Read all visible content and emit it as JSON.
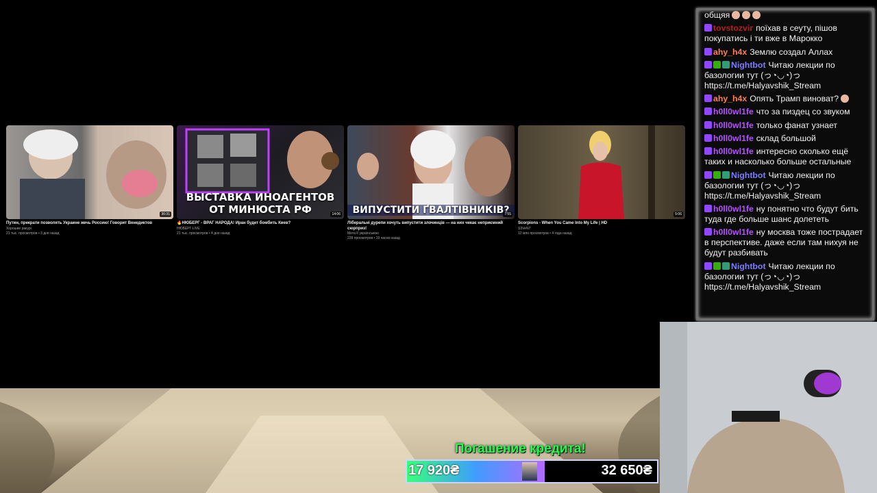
{
  "videos": [
    {
      "title": "Путин, прекрати позволять Украине жечь Россию! Говорит Венедиктов",
      "channel": "Хорошие ракурі",
      "meta": "21 тыс. просмотров • 3 дня назад",
      "duration": "30:31",
      "thumb_text": ""
    },
    {
      "title": "🔥НЮБЕРГ - ВРАГ НАРОДА! Иран будет бомбить Киев?",
      "channel": "НЮБЕРГ LIVE",
      "meta": "21 тыс. просмотров • 4 дня назад",
      "duration": "14:06",
      "thumb_text": "ВЫСТАВКА ИНОАГЕНТОВ ОТ МИНЮСТА РФ"
    },
    {
      "title": "Ліберальні дурепи хочуть випустити злочинців — на них чекає неприємний сюрприз!",
      "channel": "Мета К українською",
      "meta": "228 просмотров • 19 часов назад",
      "duration": "7:55",
      "thumb_text": "ВИПУСТИТИ ҐВАЛТІВНИКІВ?"
    },
    {
      "title": "Scorpions - When You Came Into My Life | HD",
      "channel": "S3VeN7",
      "meta": "12 млн просмотров • 4 года назад",
      "duration": "5:06",
      "thumb_text": ""
    }
  ],
  "chat": [
    {
      "user": "",
      "text": "общяя",
      "badges": [],
      "color": "#ffffff",
      "emotes": 3
    },
    {
      "user": "tovstozvir",
      "text": "поїхав в сеуту, пішов покупатись і ти вже в Марокко",
      "badges": [
        "twitch"
      ],
      "color": "#b22222",
      "emotes": 0
    },
    {
      "user": "ahy_h4x",
      "text": "Землю создал Аллах",
      "badges": [
        "twitch"
      ],
      "color": "#ff7f50",
      "emotes": 0
    },
    {
      "user": "Nightbot",
      "text": "Читаю лекции по базологии тут (っ◔◡◔)っ https://t.me/Halyavshik_Stream",
      "badges": [
        "twitch",
        "mod",
        "bot"
      ],
      "color": "#7c7cff",
      "emotes": 0
    },
    {
      "user": "ahy_h4x",
      "text": "Опять Трамп виноват?",
      "badges": [
        "twitch"
      ],
      "color": "#ff7f50",
      "emotes": 1
    },
    {
      "user": "h0ll0wl1fe",
      "text": "что за пиздец со звуком",
      "badges": [
        "twitch"
      ],
      "color": "#b452ff",
      "emotes": 0
    },
    {
      "user": "h0ll0wl1fe",
      "text": "только фанат узнает",
      "badges": [
        "twitch"
      ],
      "color": "#b452ff",
      "emotes": 0
    },
    {
      "user": "h0ll0wl1fe",
      "text": "склад большой",
      "badges": [
        "twitch"
      ],
      "color": "#b452ff",
      "emotes": 0
    },
    {
      "user": "h0ll0wl1fe",
      "text": "интересно сколько ещё таких и насколько больше остальные",
      "badges": [
        "twitch"
      ],
      "color": "#b452ff",
      "emotes": 0
    },
    {
      "user": "Nightbot",
      "text": "Читаю лекции по базологии тут (っ◔◡◔)っ https://t.me/Halyavshik_Stream",
      "badges": [
        "twitch",
        "mod",
        "bot"
      ],
      "color": "#7c7cff",
      "emotes": 0
    },
    {
      "user": "h0ll0wl1fe",
      "text": "ну понятно что будут бить туда где больше шанс долететь",
      "badges": [
        "twitch"
      ],
      "color": "#b452ff",
      "emotes": 0
    },
    {
      "user": "h0ll0wl1fe",
      "text": "ну москва тоже пострадает в перспективе. даже если там нихуя не будут разбивать",
      "badges": [
        "twitch"
      ],
      "color": "#b452ff",
      "emotes": 0
    },
    {
      "user": "Nightbot",
      "text": "Читаю лекции по базологии тут (っ◔◡◔)っ https://t.me/Halyavshik_Stream",
      "badges": [
        "twitch",
        "mod",
        "bot"
      ],
      "color": "#7c7cff",
      "emotes": 0
    }
  ],
  "credit": {
    "title": "Погашение кредита!",
    "current": "17 920₴",
    "goal": "32 650₴",
    "progress": 0.55,
    "accent": "#1dff4b"
  }
}
